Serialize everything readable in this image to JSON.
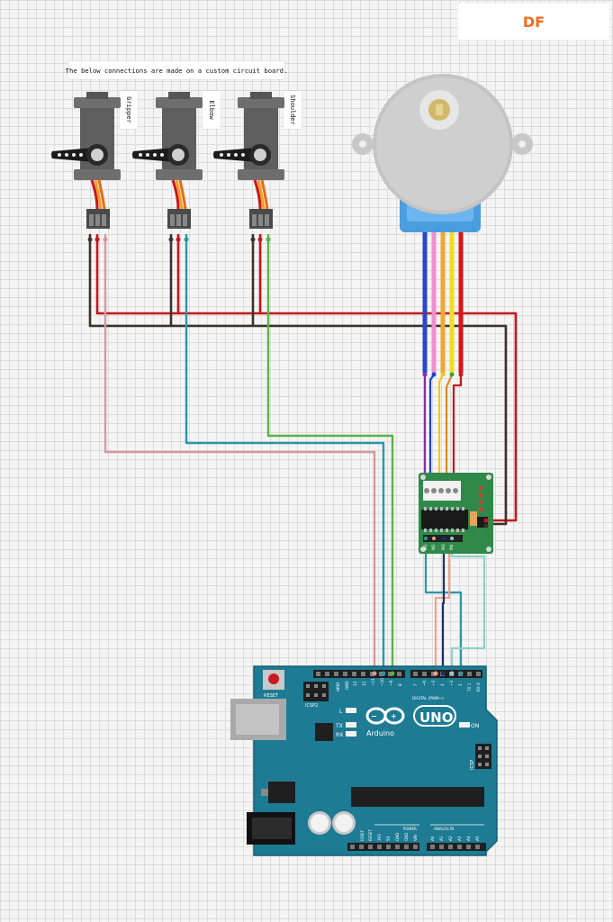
{
  "logo": {
    "text": "DF"
  },
  "note": {
    "text": "The below connections are made on a custom circuit board."
  },
  "servos": [
    {
      "label": "Gripper"
    },
    {
      "label": "Elbow"
    },
    {
      "label": "Shoulder"
    }
  ],
  "arduino": {
    "reset_label": "RESET",
    "icsp2_label": "ICSP2",
    "icsp_label": "ICSP",
    "aref_label": "AREF",
    "gnd_label": "GND",
    "digital_label": "DIGITAL (PWM~)",
    "led_l": "L",
    "led_tx": "TX",
    "led_rx": "RX",
    "on_label": "ON",
    "brand": "Arduino",
    "model": "UNO",
    "power_label": "POWER",
    "analog_label": "ANALOG IN",
    "top_pins": [
      "13",
      "12",
      "~11",
      "~10",
      "~9",
      "8",
      "7",
      "~6",
      "~5",
      "4",
      "~3",
      "2",
      "TX 1",
      "RX 0"
    ],
    "power_pins": [
      "IOREF",
      "RESET",
      "3V3",
      "5V",
      "GND",
      "GND",
      "VIN"
    ],
    "analog_pins": [
      "A0",
      "A1",
      "A2",
      "A3",
      "A4",
      "A5"
    ]
  },
  "driver": {
    "inputs": [
      "IN1",
      "IN2",
      "IN3",
      "IN4"
    ]
  },
  "colors": {
    "wire_red": "#c8151b",
    "wire_black": "#3b3326",
    "wire_pink": "#d49a9a",
    "wire_teal": "#2a97a5",
    "wire_green": "#5ab245",
    "board_blue": "#1d7b94",
    "driver_green": "#2f8a4a",
    "motor_blue": "#4b9ede",
    "logo_orange": "#f26c22"
  }
}
